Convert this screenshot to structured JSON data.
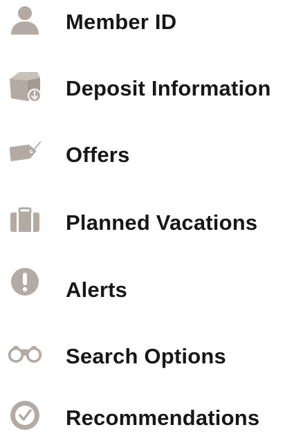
{
  "menu": {
    "items": [
      {
        "label": "Member ID",
        "icon": "person-icon"
      },
      {
        "label": "Deposit Information",
        "icon": "box-deposit-icon"
      },
      {
        "label": "Offers",
        "icon": "tag-icon"
      },
      {
        "label": "Planned Vacations",
        "icon": "suitcase-icon"
      },
      {
        "label": "Alerts",
        "icon": "alert-icon"
      },
      {
        "label": "Search Options",
        "icon": "binoculars-icon"
      },
      {
        "label": "Recommendations",
        "icon": "checkmark-icon"
      }
    ]
  },
  "colors": {
    "icon": "#b3aba3",
    "icon_dark": "#8c847c",
    "label": "#171717",
    "background": "#ffffff"
  }
}
